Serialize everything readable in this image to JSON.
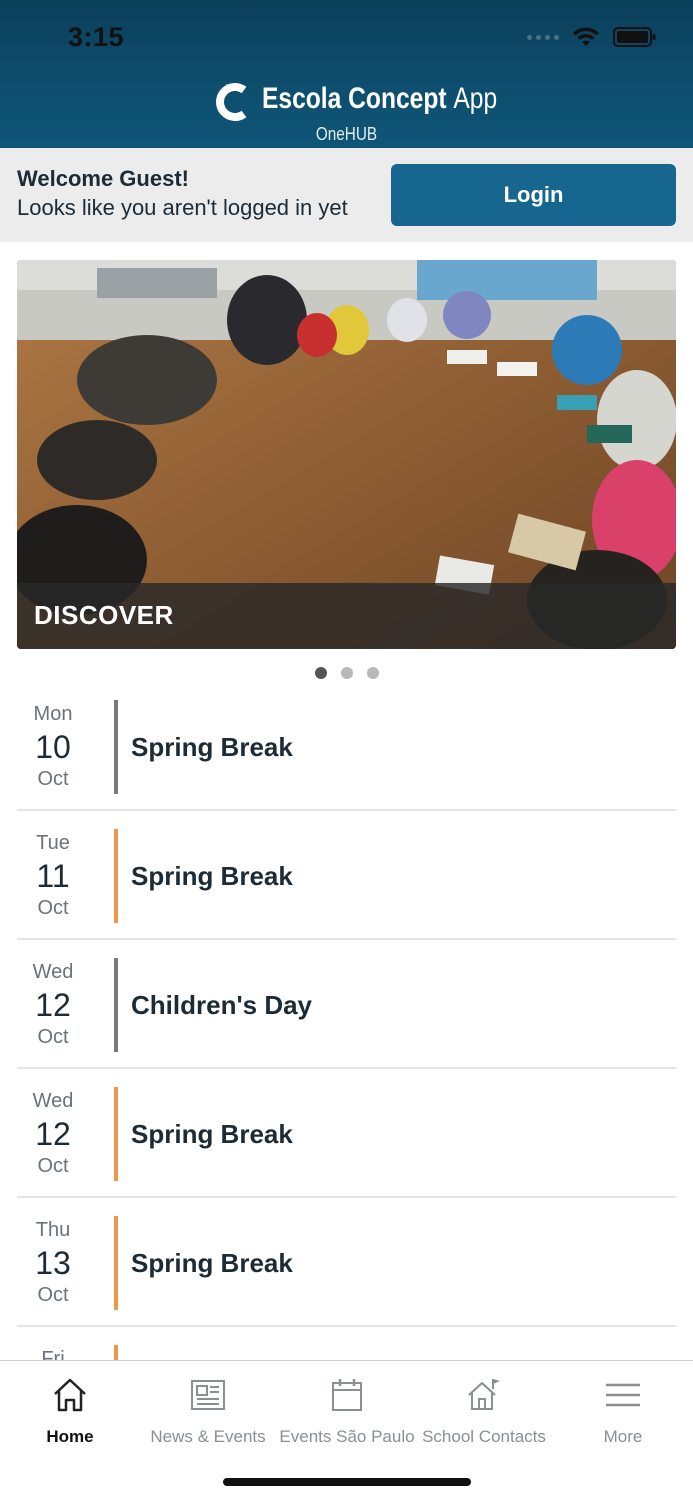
{
  "status_bar": {
    "time": "3:15",
    "icons": [
      "cellular-icon",
      "wifi-icon",
      "battery-icon"
    ]
  },
  "header": {
    "logo_icon": "escola-c-logo",
    "brand_name": "Escola Concept",
    "brand_suffix": "App",
    "subtitle": "OneHUB",
    "colors": {
      "top": "#0b3f5a",
      "bottom": "#0f5678"
    }
  },
  "welcome": {
    "title": "Welcome Guest!",
    "message": "Looks like you aren't logged in yet",
    "login_label": "Login",
    "login_color": "#176690"
  },
  "carousel": {
    "caption": "DISCOVER",
    "slide_count": 3,
    "active_index": 0
  },
  "events": [
    {
      "dow": "Mon",
      "day": "10",
      "month": "Oct",
      "title": "Spring Break",
      "bar_color": "#7b7b7b"
    },
    {
      "dow": "Tue",
      "day": "11",
      "month": "Oct",
      "title": "Spring Break",
      "bar_color": "#f0954a"
    },
    {
      "dow": "Wed",
      "day": "12",
      "month": "Oct",
      "title": "Children's Day",
      "bar_color": "#7b7b7b"
    },
    {
      "dow": "Wed",
      "day": "12",
      "month": "Oct",
      "title": "Spring Break",
      "bar_color": "#f0954a"
    },
    {
      "dow": "Thu",
      "day": "13",
      "month": "Oct",
      "title": "Spring Break",
      "bar_color": "#f0954a"
    },
    {
      "dow": "Fri",
      "day": "",
      "month": "",
      "title": "",
      "bar_color": "#f0954a"
    }
  ],
  "tabbar": {
    "tabs": [
      {
        "label": "Home",
        "icon": "home-icon",
        "active": true
      },
      {
        "label": "News & Events",
        "icon": "newspaper-icon",
        "active": false
      },
      {
        "label": "Events São Paulo",
        "icon": "calendar-icon",
        "active": false
      },
      {
        "label": "School Contacts",
        "icon": "school-contacts-icon",
        "active": false
      },
      {
        "label": "More",
        "icon": "menu-icon",
        "active": false
      }
    ]
  }
}
